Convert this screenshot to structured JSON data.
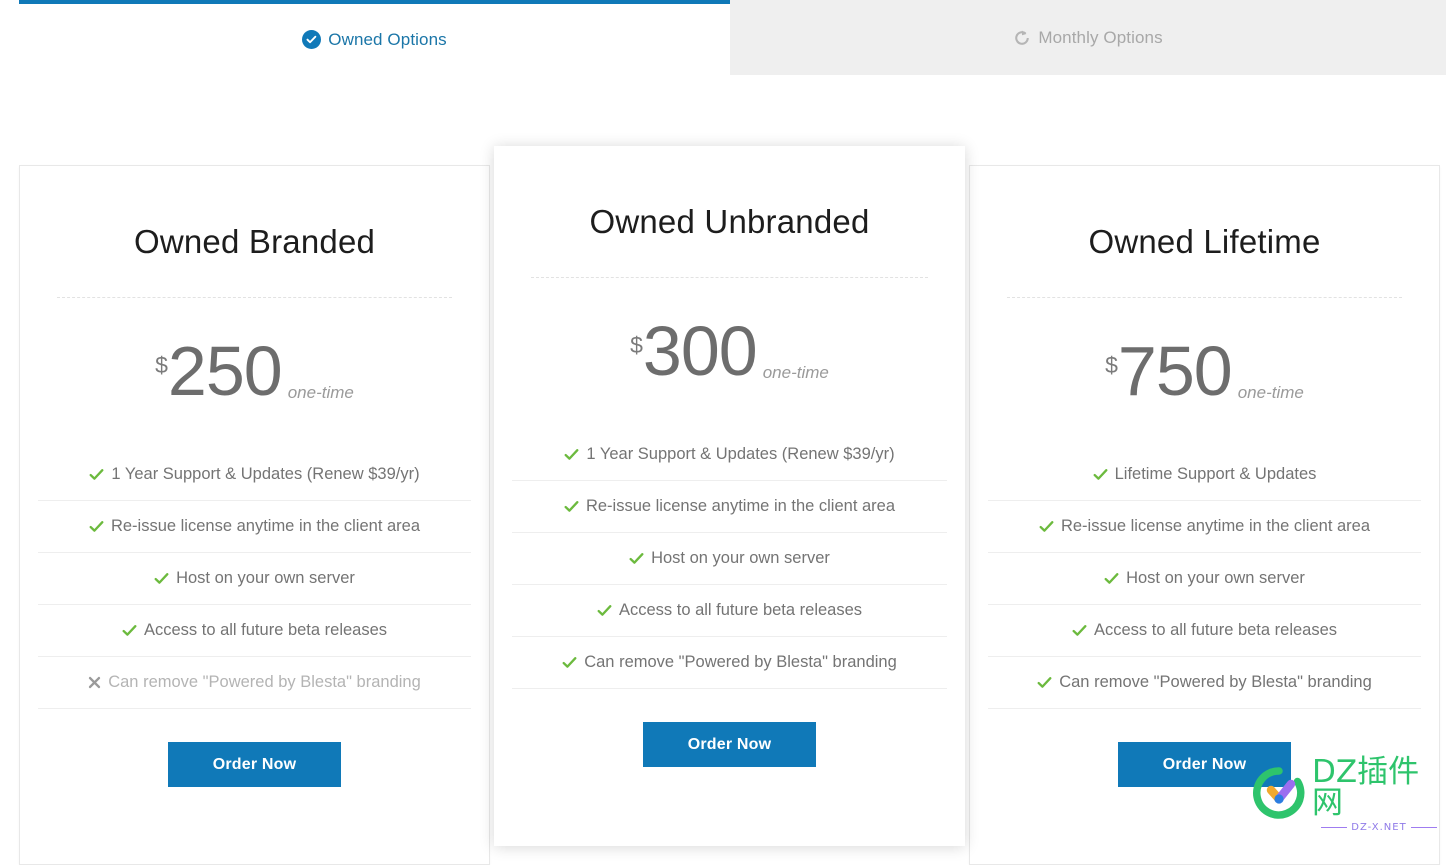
{
  "tabs": [
    {
      "id": "owned",
      "label": "Owned Options",
      "icon": "check-circle-icon",
      "active": true
    },
    {
      "id": "monthly",
      "label": "Monthly Options",
      "icon": "refresh-icon",
      "active": false
    }
  ],
  "colors": {
    "accent_blue": "#1079b8",
    "tab_inactive_bg": "#efefef",
    "tab_inactive_text": "#a8a8a8",
    "feature_check_green": "#6cba3e",
    "feature_x_gray": "#9a9a9a",
    "price_gray": "#6d6d6d",
    "watermark_green": "#2ec46c",
    "watermark_purple": "#8f7ae8"
  },
  "plans": [
    {
      "id": "owned-branded",
      "title": "Owned Branded",
      "currency": "$",
      "amount": "250",
      "term": "one-time",
      "features": [
        {
          "text": "1 Year Support & Updates (Renew $39/yr)",
          "included": true
        },
        {
          "text": "Re-issue license anytime in the client area",
          "included": true
        },
        {
          "text": "Host on your own server",
          "included": true
        },
        {
          "text": "Access to all future beta releases",
          "included": true
        },
        {
          "text": "Can remove \"Powered by Blesta\" branding",
          "included": false
        }
      ],
      "cta": "Order Now"
    },
    {
      "id": "owned-unbranded",
      "title": "Owned Unbranded",
      "currency": "$",
      "amount": "300",
      "term": "one-time",
      "features": [
        {
          "text": "1 Year Support & Updates (Renew $39/yr)",
          "included": true
        },
        {
          "text": "Re-issue license anytime in the client area",
          "included": true
        },
        {
          "text": "Host on your own server",
          "included": true
        },
        {
          "text": "Access to all future beta releases",
          "included": true
        },
        {
          "text": "Can remove \"Powered by Blesta\" branding",
          "included": true
        }
      ],
      "cta": "Order Now"
    },
    {
      "id": "owned-lifetime",
      "title": "Owned Lifetime",
      "currency": "$",
      "amount": "750",
      "term": "one-time",
      "features": [
        {
          "text": "Lifetime Support & Updates",
          "included": true
        },
        {
          "text": "Re-issue license anytime in the client area",
          "included": true
        },
        {
          "text": "Host on your own server",
          "included": true
        },
        {
          "text": "Access to all future beta releases",
          "included": true
        },
        {
          "text": "Can remove \"Powered by Blesta\" branding",
          "included": true
        }
      ],
      "cta": "Order Now"
    }
  ],
  "watermark": {
    "title": "DZ插件网",
    "subtitle": "DZ-X.NET",
    "logo_icon": "circle-check-logo-icon"
  }
}
